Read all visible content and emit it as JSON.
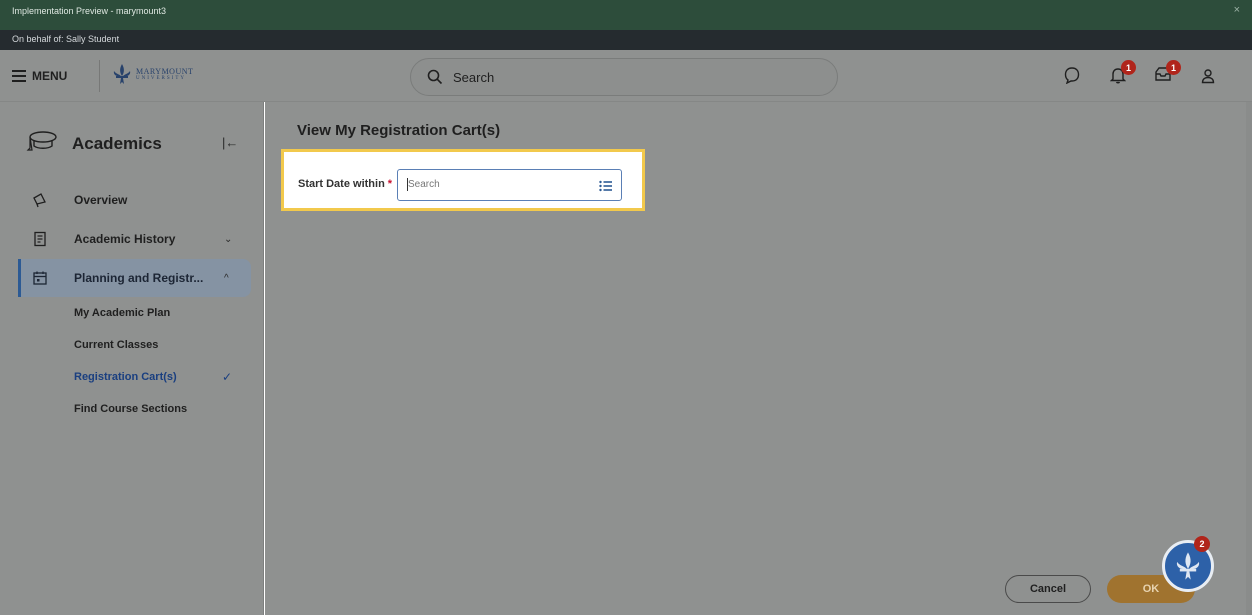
{
  "window": {
    "title": "Implementation Preview - marymount3",
    "close_glyph": "×",
    "on_behalf": "On behalf of: Sally Student"
  },
  "header": {
    "menu_label": "MENU",
    "logo_line1": "MARYMOUNT",
    "logo_line2": "UNIVERSITY",
    "search_placeholder": "Search",
    "notifications_count": "1",
    "inbox_count": "1",
    "icons": [
      "hamburger-icon",
      "fleur-de-lis-logo",
      "search-icon",
      "chat-icon",
      "bell-icon",
      "inbox-icon",
      "profile-icon"
    ]
  },
  "sidebar": {
    "title": "Academics",
    "collapse_glyph": "|←",
    "items": [
      {
        "label": "Overview",
        "icon": "megaphone-icon"
      },
      {
        "label": "Academic History",
        "icon": "document-icon",
        "chevron": "⌄"
      },
      {
        "label": "Planning and Registr...",
        "icon": "calendar-icon",
        "chevron": "^",
        "active": true
      }
    ],
    "sub_items": [
      {
        "label": "My Academic Plan"
      },
      {
        "label": "Current Classes"
      },
      {
        "label": "Registration Cart(s)",
        "selected": true,
        "check": "✓"
      },
      {
        "label": "Find Course Sections"
      }
    ]
  },
  "main": {
    "page_title": "View My Registration Cart(s)",
    "field_label": "Start Date within",
    "required_mark": "*",
    "field_placeholder": "Search",
    "cancel_label": "Cancel",
    "ok_label": "OK",
    "help_count": "2"
  },
  "colors": {
    "topbar": "#2d4d3b",
    "overlay_gray": "#8f9190",
    "highlight_border": "#f2c94c",
    "active_blue": "#2c5a94",
    "ok_orange": "#a0732f",
    "badge_red": "#b0251b"
  }
}
